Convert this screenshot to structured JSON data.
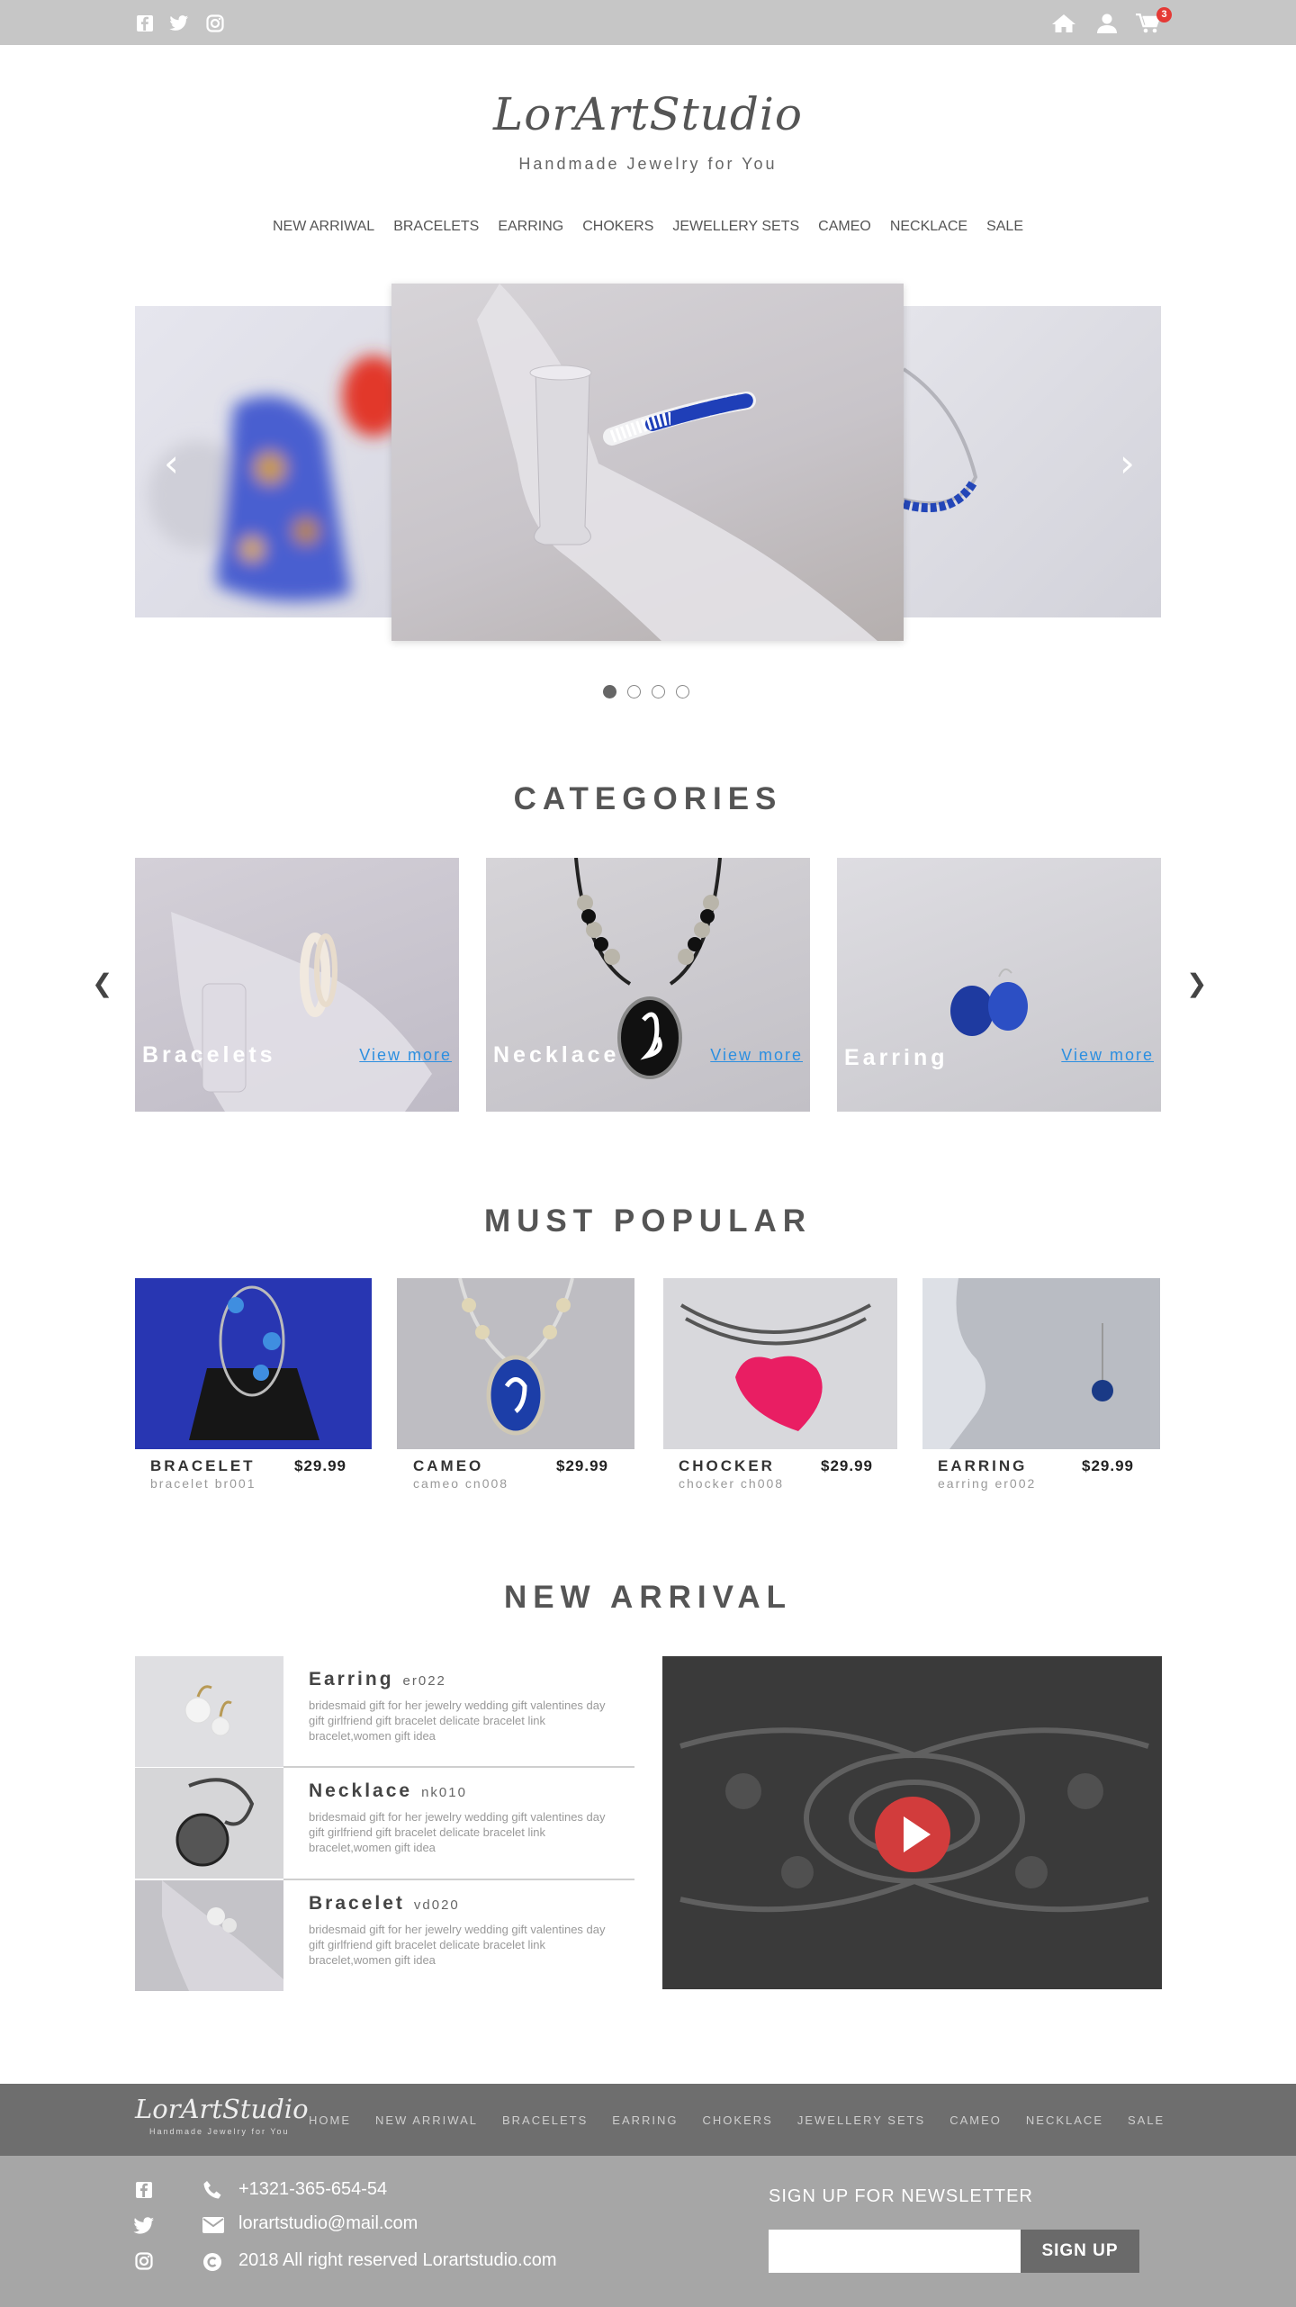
{
  "topbar": {
    "cart_count": "3"
  },
  "brand": {
    "name": "LorArtStudio",
    "tagline": "Handmade Jewelry for You"
  },
  "nav": [
    "NEW ARRIWAL",
    "BRACELETS",
    "EARRING",
    "CHOKERS",
    "JEWELLERY SETS",
    "CAMEO",
    "NECKLACE",
    "SALE"
  ],
  "icons": {
    "facebook": "facebook-icon",
    "twitter": "twitter-icon",
    "instagram": "instagram-icon",
    "home": "home-icon",
    "user": "user-icon",
    "cart": "cart-icon"
  },
  "slider": {
    "prev": "‹",
    "next": "›",
    "active_slide": 1,
    "slide_count": 4
  },
  "categories": {
    "title": "CATEGORIES",
    "items": [
      {
        "name": "Bracelets",
        "more": "View more"
      },
      {
        "name": "Necklace",
        "more": "View more"
      },
      {
        "name": "Earring",
        "more": "View more"
      }
    ]
  },
  "popular": {
    "title": "MUST POPULAR",
    "items": [
      {
        "title": "BRACELET",
        "sub": "bracelet br001",
        "price": "$29.99"
      },
      {
        "title": "CAMEO",
        "sub": "cameo cn008",
        "price": "$29.99"
      },
      {
        "title": "CHOCKER",
        "sub": "chocker ch008",
        "price": "$29.99"
      },
      {
        "title": "EARRING",
        "sub": "earring er002",
        "price": "$29.99"
      }
    ]
  },
  "new_arrival": {
    "title": "NEW ARRIVAL",
    "items": [
      {
        "name": "Earring",
        "code": "er022",
        "desc": "bridesmaid gift for her jewelry wedding gift valentines day gift girlfriend gift bracelet delicate bracelet link bracelet,women gift idea"
      },
      {
        "name": "Necklace",
        "code": "nk010",
        "desc": "bridesmaid gift for her jewelry wedding gift valentines day gift girlfriend gift bracelet delicate bracelet link bracelet,women gift idea"
      },
      {
        "name": "Bracelet",
        "code": "vd020",
        "desc": "bridesmaid gift for her jewelry wedding gift valentines day gift girlfriend gift bracelet delicate bracelet link bracelet,women gift idea"
      }
    ]
  },
  "footer": {
    "nav": [
      "HOME",
      "NEW ARRIWAL",
      "BRACELETS",
      "EARRING",
      "CHOKERS",
      "JEWELLERY SETS",
      "CAMEO",
      "NECKLACE",
      "SALE"
    ],
    "phone": "+1321-365-654-54",
    "email": "lorartstudio@mail.com",
    "copyright": "2018 All right reserved  Lorartstudio.com",
    "newsletter_title": "SIGN UP FOR NEWSLETTER",
    "signup": "SIGN UP"
  }
}
